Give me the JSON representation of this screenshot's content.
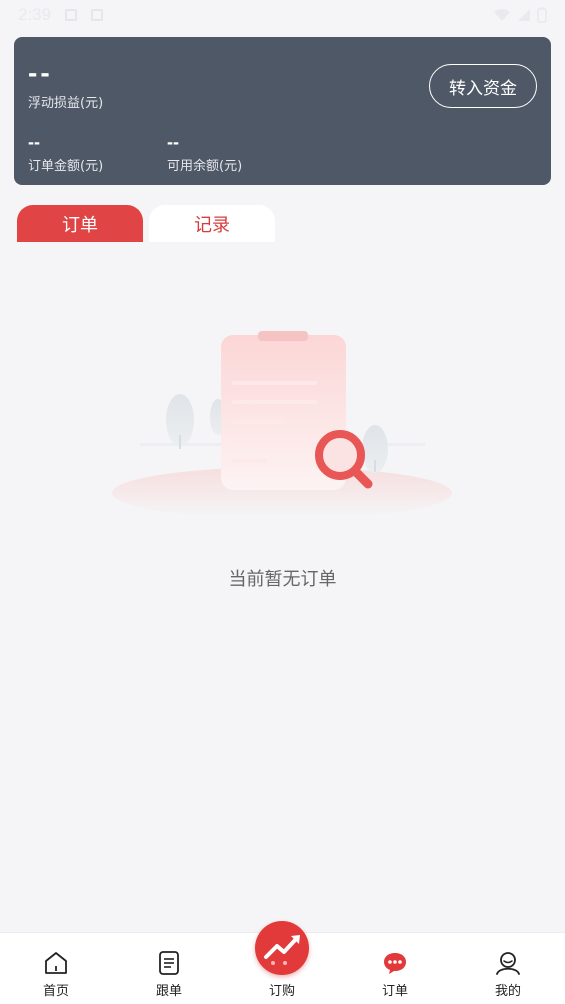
{
  "status_bar": {
    "time": "2:39"
  },
  "account": {
    "float_pl_value": "--",
    "float_pl_label": "浮动损益(元)",
    "order_amount_value": "--",
    "order_amount_label": "订单金额(元)",
    "available_value": "--",
    "available_label": "可用余额(元)",
    "transfer_label": "转入资金"
  },
  "tabs": [
    {
      "label": "订单",
      "active": true
    },
    {
      "label": "记录",
      "active": false
    }
  ],
  "empty_state": {
    "text": "当前暂无订单"
  },
  "bottom_nav": [
    {
      "label": "首页",
      "icon": "home-icon"
    },
    {
      "label": "跟单",
      "icon": "document-icon"
    },
    {
      "label": "订购",
      "icon": "trend-up-icon"
    },
    {
      "label": "订单",
      "icon": "chat-bubble-icon",
      "active": true
    },
    {
      "label": "我的",
      "icon": "user-icon"
    }
  ],
  "colors": {
    "accent": "#e04444",
    "card_bg": "#4f5867",
    "page_bg": "#f5f5f7"
  }
}
